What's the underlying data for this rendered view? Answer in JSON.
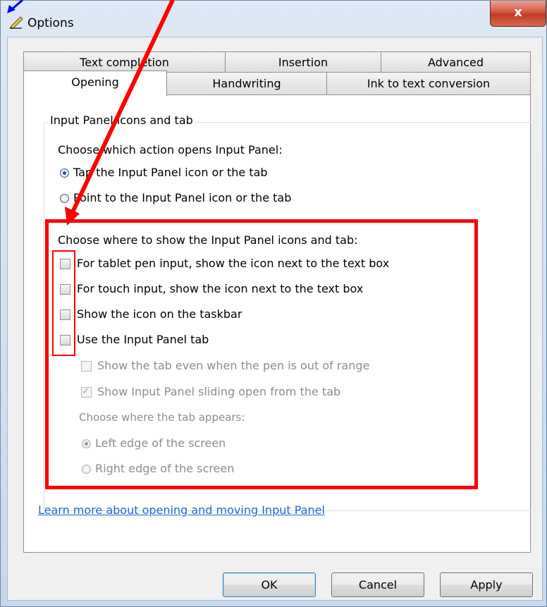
{
  "window": {
    "title": "Options",
    "close_label": "x"
  },
  "tabs": {
    "row1": [
      {
        "label": "Text completion"
      },
      {
        "label": "Insertion"
      },
      {
        "label": "Advanced"
      }
    ],
    "row2": [
      {
        "label": "Opening",
        "selected": true
      },
      {
        "label": "Handwriting"
      },
      {
        "label": "Ink to text conversion"
      }
    ]
  },
  "group": {
    "legend": "Input Panel icons and tab",
    "action_prompt": "Choose which action opens Input Panel:",
    "action_options": [
      {
        "label": "Tap the Input Panel icon or the tab",
        "selected": true
      },
      {
        "label": "Point to the Input Panel icon or the tab",
        "selected": false
      }
    ],
    "show_prompt": "Choose where to show the Input Panel icons and tab:",
    "show_options": [
      {
        "label": "For tablet pen input, show the icon next to the text box",
        "checked": false
      },
      {
        "label": "For touch input, show the icon next to the text box",
        "checked": false
      },
      {
        "label": "Show the icon on the taskbar",
        "checked": false
      },
      {
        "label": "Use the Input Panel tab",
        "checked": false
      }
    ],
    "tab_options": [
      {
        "label": "Show the tab even when the pen is out of range",
        "checked": false,
        "enabled": false
      },
      {
        "label": "Show Input Panel sliding open from the tab",
        "checked": true,
        "enabled": false
      }
    ],
    "edge_prompt": "Choose where the tab appears:",
    "edge_options": [
      {
        "label": "Left edge of the screen",
        "selected": true,
        "enabled": false
      },
      {
        "label": "Right edge of the screen",
        "selected": false,
        "enabled": false
      }
    ]
  },
  "link": "Learn more about opening and moving Input Panel",
  "buttons": {
    "ok": "OK",
    "cancel": "Cancel",
    "apply": "Apply"
  },
  "colors": {
    "annotation_red": "#ff0000",
    "annotation_blue": "#0000ff",
    "link": "#1f67d2"
  },
  "icons": {
    "title": "pen-icon",
    "close": "close-icon"
  }
}
